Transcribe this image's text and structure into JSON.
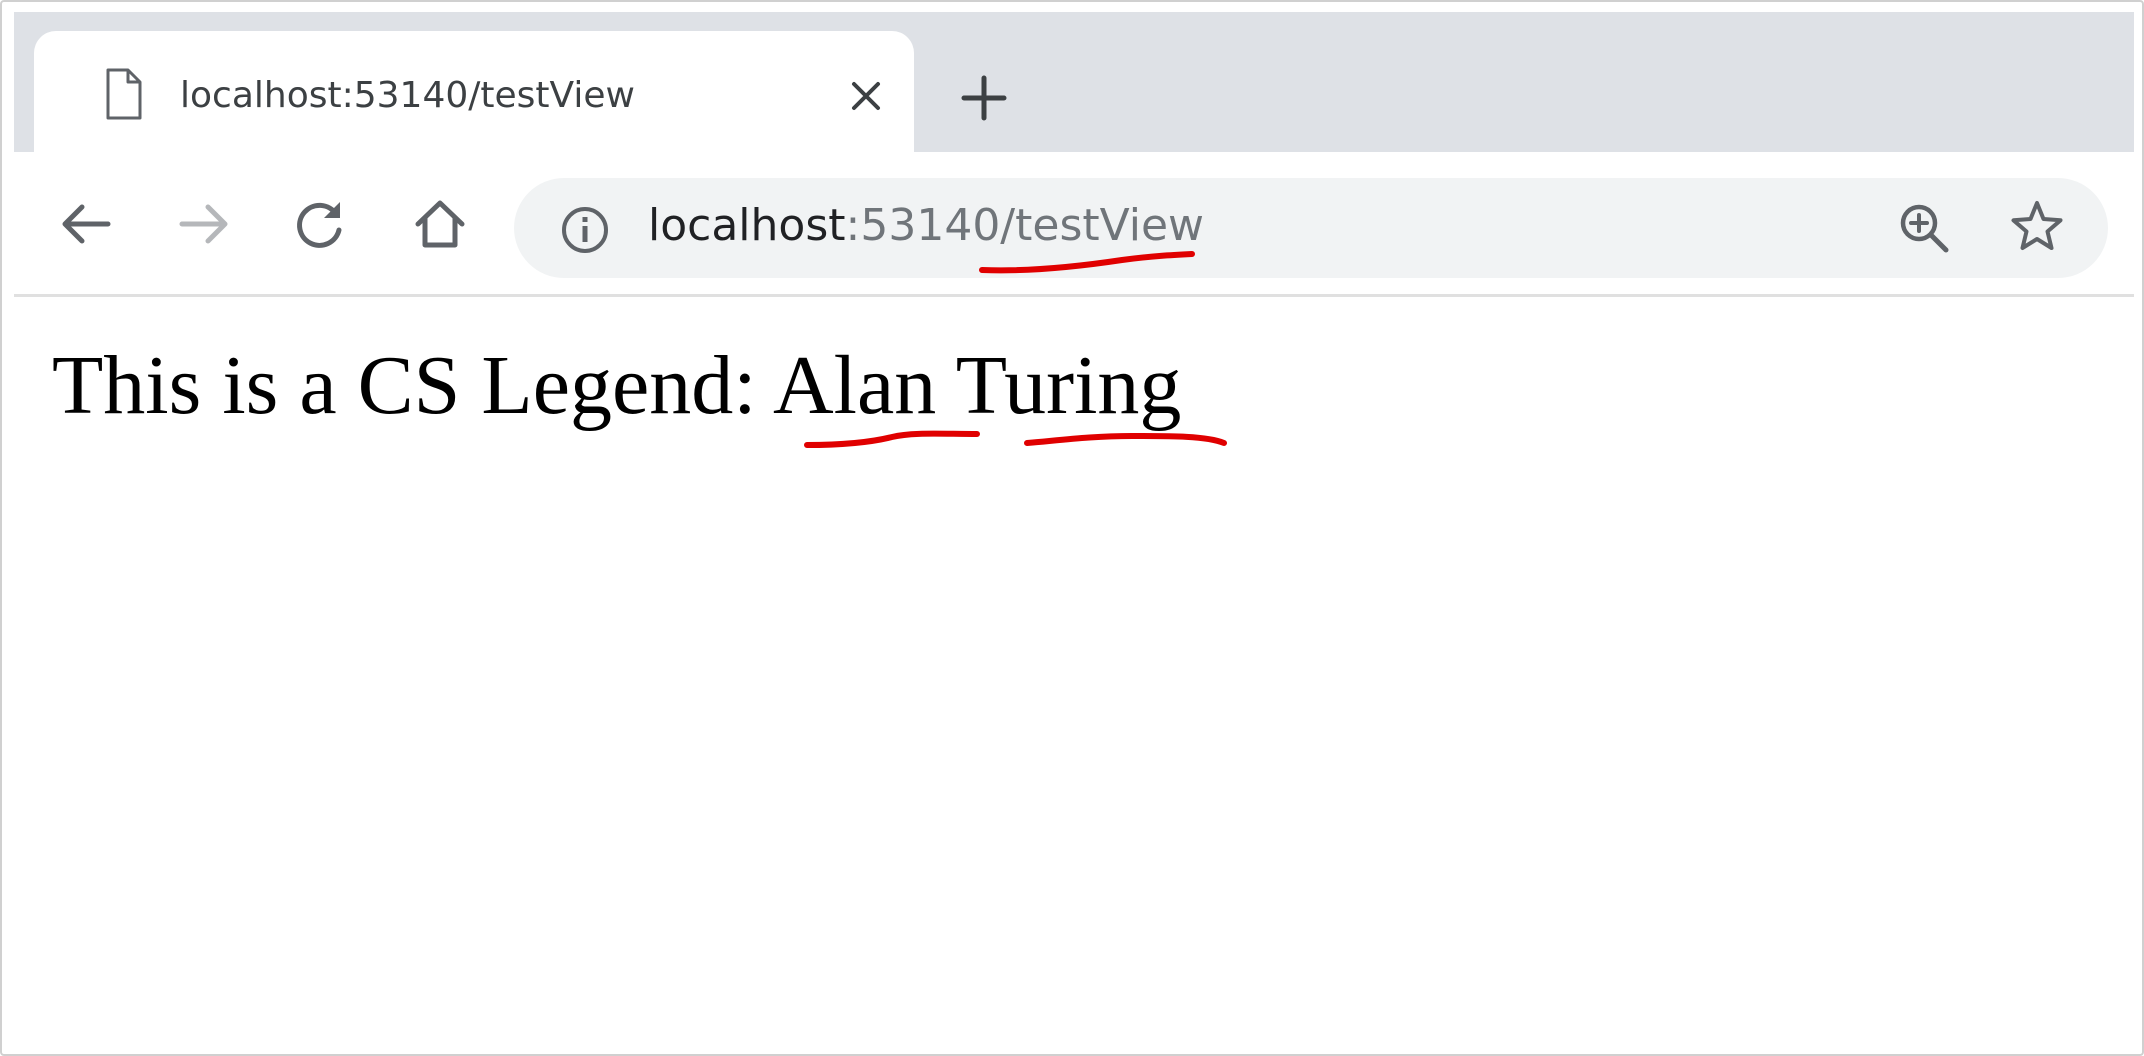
{
  "tab": {
    "title": "localhost:53140/testView"
  },
  "address_bar": {
    "host": "localhost",
    "rest": ":53140/testView"
  },
  "icons": {
    "tab": "page-icon",
    "close": "close-icon",
    "new_tab": "plus-icon",
    "back": "back-arrow-icon",
    "forward": "forward-arrow-icon",
    "reload": "reload-icon",
    "home": "home-icon",
    "info": "info-icon",
    "zoom": "zoom-in-icon",
    "bookmark": "star-icon"
  },
  "page": {
    "text": "This is a CS Legend: Alan Turing"
  },
  "colors": {
    "tabstrip": "#dee1e6",
    "omnibox": "#f1f3f4",
    "annotation": "#e00000"
  }
}
